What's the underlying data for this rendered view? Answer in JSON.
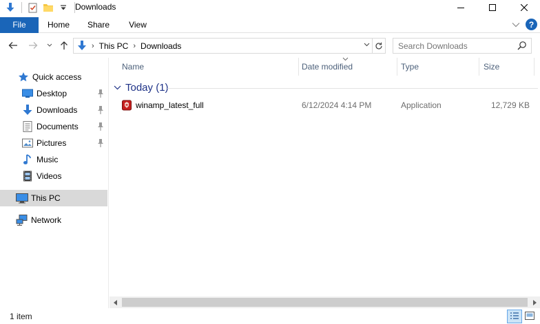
{
  "window": {
    "title": "Downloads",
    "controls": {
      "minimize": "—",
      "maximize": "☐",
      "close": "✕"
    }
  },
  "ribbon": {
    "tabs": [
      {
        "label": "File",
        "active": true
      },
      {
        "label": "Home"
      },
      {
        "label": "Share"
      },
      {
        "label": "View"
      }
    ],
    "help": "?"
  },
  "address": {
    "crumbs": [
      "This PC",
      "Downloads"
    ],
    "search_placeholder": "Search Downloads"
  },
  "sidebar": {
    "items": [
      {
        "label": "Quick access",
        "icon": "star-icon"
      },
      {
        "label": "Desktop",
        "icon": "desktop-icon",
        "pinned": true
      },
      {
        "label": "Downloads",
        "icon": "download-arrow-icon",
        "pinned": true
      },
      {
        "label": "Documents",
        "icon": "documents-icon",
        "pinned": true
      },
      {
        "label": "Pictures",
        "icon": "pictures-icon",
        "pinned": true
      },
      {
        "label": "Music",
        "icon": "music-note-icon"
      },
      {
        "label": "Videos",
        "icon": "film-icon"
      },
      {
        "label": "This PC",
        "icon": "computer-icon",
        "selected": true
      },
      {
        "label": "Network",
        "icon": "network-icon"
      }
    ]
  },
  "columns": {
    "name": "Name",
    "date": "Date modified",
    "type": "Type",
    "size": "Size"
  },
  "group": {
    "label": "Today (1)"
  },
  "files": [
    {
      "name": "winamp_latest_full",
      "date": "6/12/2024 4:14 PM",
      "type": "Application",
      "size": "12,729 KB",
      "icon": "winamp-app-icon"
    }
  ],
  "status": {
    "item_count": "1 item"
  },
  "colors": {
    "accent": "#1a65b8",
    "group_header": "#1e3287",
    "selected_sidebar": "#d9d9d9"
  }
}
